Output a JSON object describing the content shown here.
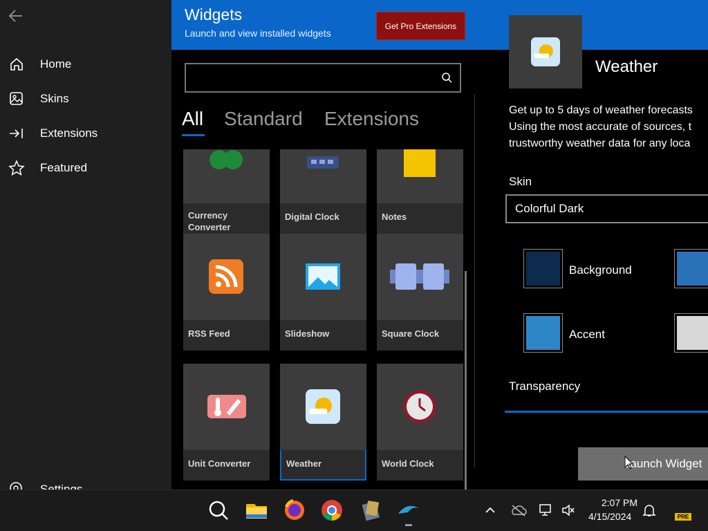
{
  "sidebar": {
    "items": [
      {
        "label": "Home",
        "icon": "home-icon"
      },
      {
        "label": "Skins",
        "icon": "skins-icon"
      },
      {
        "label": "Extensions",
        "icon": "extensions-icon"
      },
      {
        "label": "Featured",
        "icon": "star-icon"
      }
    ],
    "settings_label": "Settings"
  },
  "header": {
    "title": "Widgets",
    "subtitle": "Launch and view installed widgets",
    "pro_button": "Get Pro Extensions",
    "color": "#0a67c9"
  },
  "search": {
    "placeholder": "",
    "value": ""
  },
  "tabs": [
    {
      "label": "All",
      "active": true
    },
    {
      "label": "Standard",
      "active": false
    },
    {
      "label": "Extensions",
      "active": false
    }
  ],
  "widgets": [
    {
      "name": "Currency\nConverter",
      "icon": "currency-icon"
    },
    {
      "name": "Digital Clock",
      "icon": "digital-clock-icon"
    },
    {
      "name": "Notes",
      "icon": "notes-icon"
    },
    {
      "name": "RSS Feed",
      "icon": "rss-icon"
    },
    {
      "name": "Slideshow",
      "icon": "slideshow-icon"
    },
    {
      "name": "Square Clock",
      "icon": "square-clock-icon"
    },
    {
      "name": "Unit Converter",
      "icon": "unit-converter-icon"
    },
    {
      "name": "Weather",
      "icon": "weather-icon",
      "selected": true
    },
    {
      "name": "World Clock",
      "icon": "world-clock-icon"
    }
  ],
  "detail": {
    "name": "Weather",
    "description": [
      "Get up to 5 days of weather forecasts",
      "Using the most accurate of sources, t",
      "trustworthy weather data for any loca"
    ],
    "skin_label": "Skin",
    "skin_value": "Colorful Dark",
    "swatches": [
      {
        "label": "Background",
        "color": "#0c2b4e"
      },
      {
        "label": "",
        "color": "#2a72b8"
      },
      {
        "label": "Accent",
        "color": "#2e86c9"
      },
      {
        "label": "",
        "color": "#d8d8d8"
      }
    ],
    "transparency_label": "Transparency",
    "launch_button": "Launch Widget"
  },
  "taskbar": {
    "time": "2:07 PM",
    "date": "4/15/2024",
    "badge": "PRE"
  }
}
